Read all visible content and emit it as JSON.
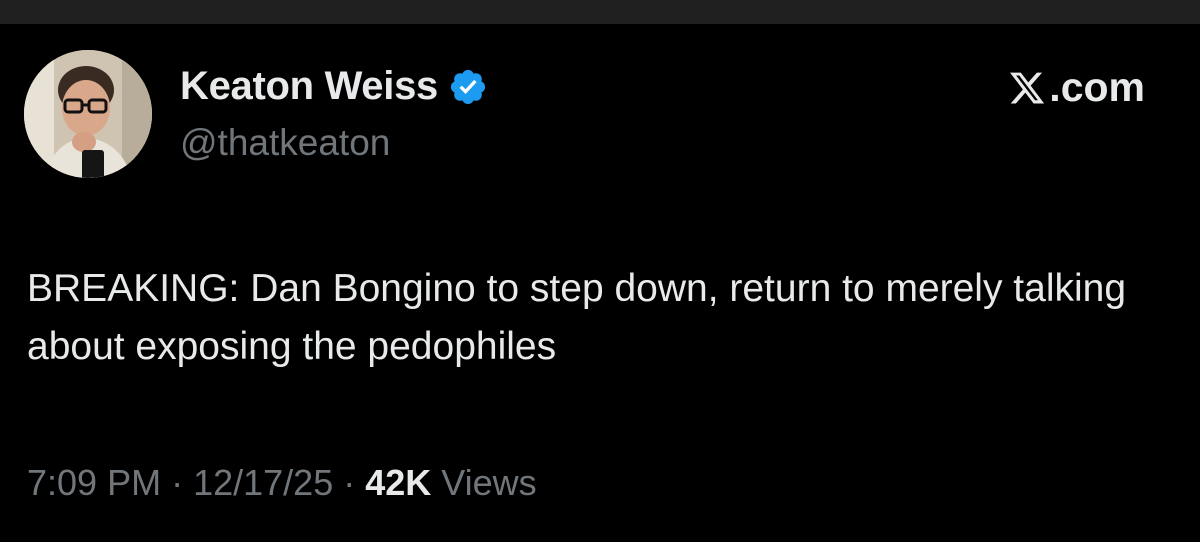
{
  "tweet": {
    "author": {
      "display_name": "Keaton Weiss",
      "handle": "@thatkeaton",
      "verified": true,
      "avatar_icon": "profile-photo"
    },
    "brand": {
      "logo_icon": "x-logo-icon",
      "text": ".com"
    },
    "text": "BREAKING: Dan Bongino to step down, return to merely talking about exposing the pedophiles",
    "meta": {
      "time": "7:09 PM",
      "separator": " · ",
      "date": "12/17/25",
      "views_count": "42K",
      "views_label": " Views"
    }
  },
  "colors": {
    "background": "#000000",
    "text_primary": "#e7e9ea",
    "text_secondary": "#71767b",
    "verified_blue": "#1d9bf0"
  }
}
